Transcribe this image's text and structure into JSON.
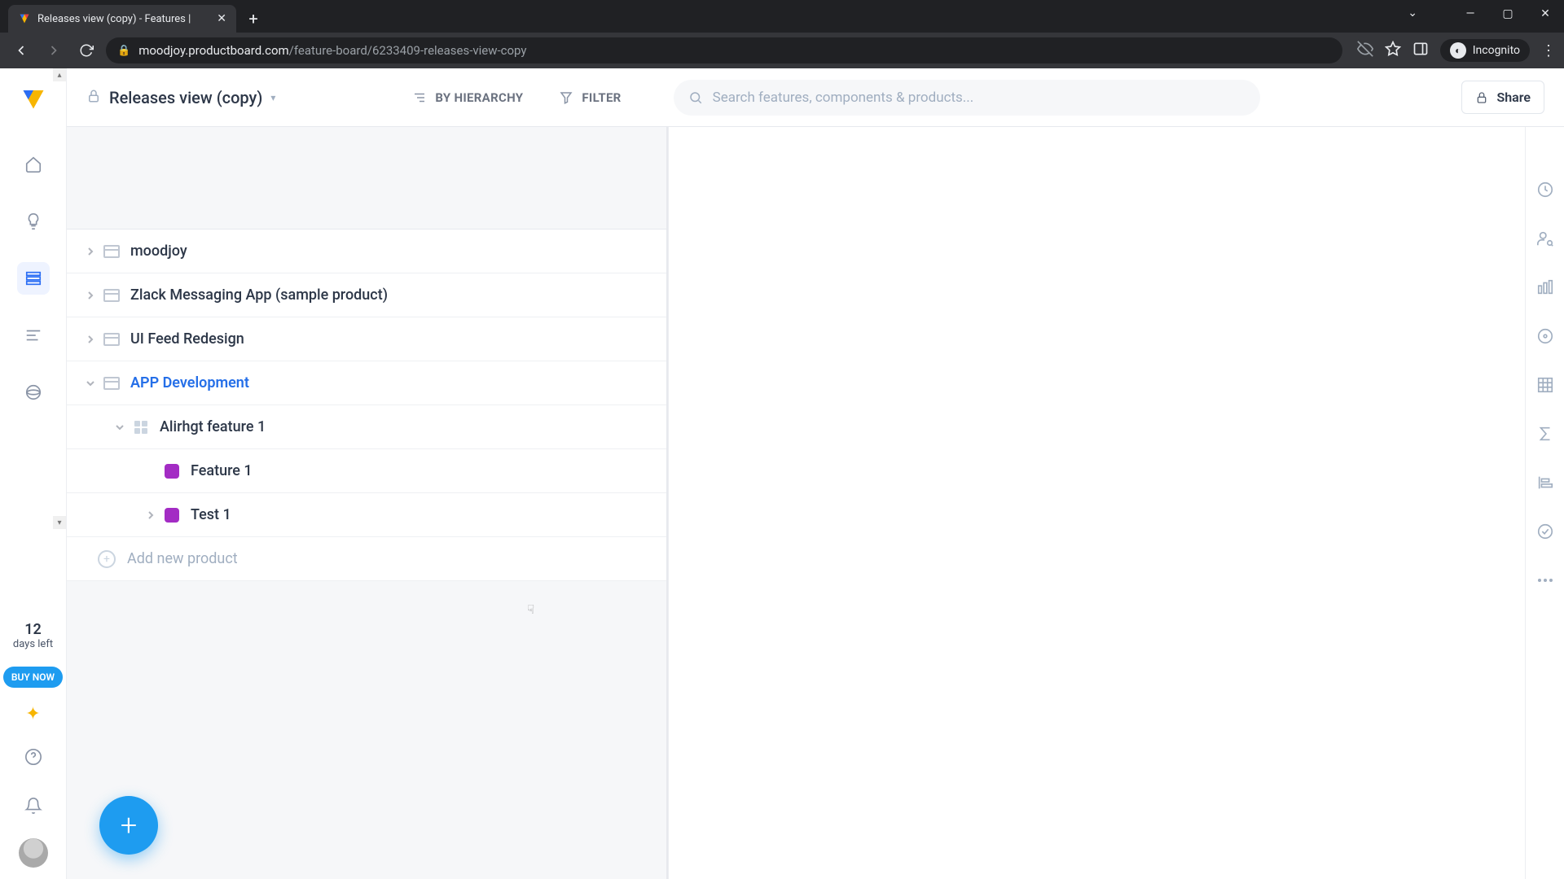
{
  "browser": {
    "tab_title": "Releases view (copy) - Features |",
    "url_domain": "moodjoy.productboard.com",
    "url_path": "/feature-board/6233409-releases-view-copy",
    "incognito_label": "Incognito"
  },
  "header": {
    "view_title": "Releases view (copy)",
    "by_hierarchy": "BY HIERARCHY",
    "filter": "FILTER",
    "search_placeholder": "Search features, components & products...",
    "share": "Share"
  },
  "trial": {
    "days": "12",
    "days_label": "days left",
    "buy": "BUY NOW"
  },
  "tree": {
    "products": [
      {
        "name": "moodjoy",
        "expanded": false
      },
      {
        "name": "Zlack Messaging App (sample product)",
        "expanded": false
      },
      {
        "name": "UI Feed Redesign",
        "expanded": false
      },
      {
        "name": "APP Development",
        "expanded": true,
        "selected": true
      }
    ],
    "child_component": "Alirhgt feature 1",
    "features": [
      {
        "name": "Feature 1",
        "has_children": false
      },
      {
        "name": "Test 1",
        "has_children": true
      }
    ],
    "add_product": "Add new product"
  }
}
